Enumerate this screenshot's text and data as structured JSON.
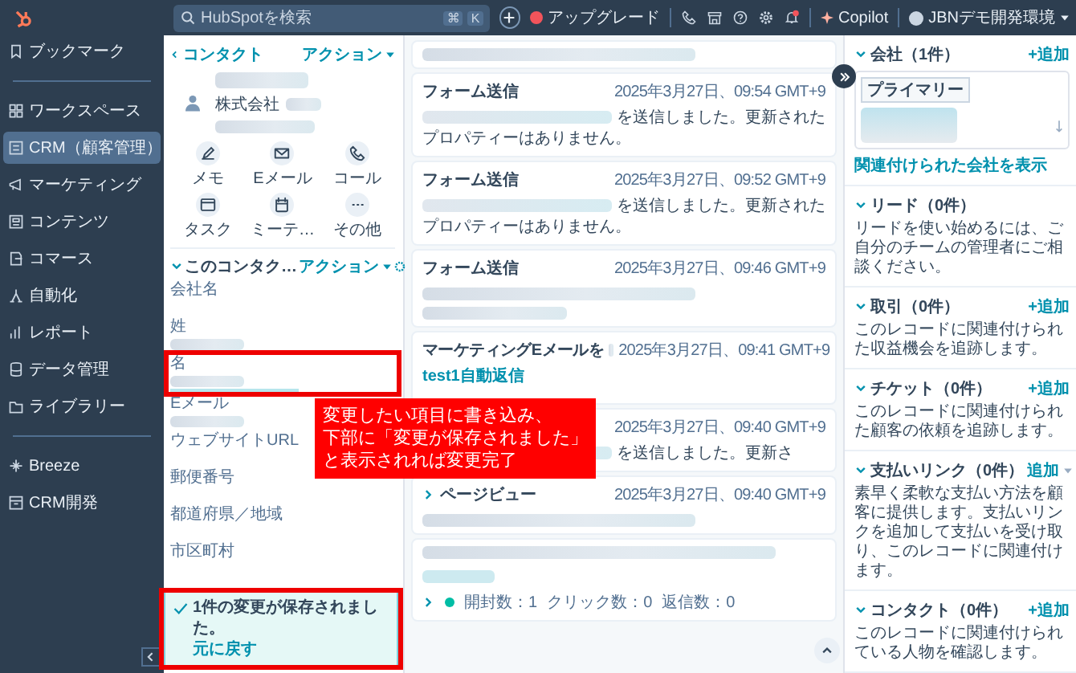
{
  "topbar": {
    "search": {
      "placeholder": "HubSpotを検索",
      "keys": [
        "⌘",
        "K"
      ]
    },
    "upgrade": "アップグレード",
    "copilot": "Copilot",
    "account": "JBNデモ開発環境",
    "has_notification": true
  },
  "sidebar": {
    "groups": [
      [
        {
          "label": "ブックマーク",
          "selected": false
        }
      ],
      [
        {
          "label": "ワークスペース",
          "selected": false
        },
        {
          "label": "CRM（顧客管理）",
          "selected": true
        },
        {
          "label": "マーケティング",
          "selected": false
        },
        {
          "label": "コンテンツ",
          "selected": false
        },
        {
          "label": "コマース",
          "selected": false
        },
        {
          "label": "自動化",
          "selected": false
        },
        {
          "label": "レポート",
          "selected": false
        },
        {
          "label": "データ管理",
          "selected": false
        },
        {
          "label": "ライブラリー",
          "selected": false
        }
      ],
      [
        {
          "label": "Breeze",
          "selected": false
        },
        {
          "label": "CRM開発",
          "selected": false
        }
      ]
    ]
  },
  "contact": {
    "back_link": "コンタクト",
    "actions_menu": "アクション",
    "company": "株式会社",
    "actions": [
      "メモ",
      "Eメール",
      "コール",
      "タスク",
      "ミーテ…",
      "その他"
    ],
    "about": {
      "title": "このコンタク…",
      "actions_menu": "アクション"
    },
    "fields": [
      {
        "label": "会社名",
        "redacted": false,
        "editing": false,
        "annotated": false
      },
      {
        "label": "姓",
        "redacted": true,
        "editing": false,
        "annotated": false
      },
      {
        "label": "名",
        "redacted": true,
        "editing": true,
        "annotated": true
      },
      {
        "label": "Eメール",
        "redacted": true,
        "editing": false,
        "annotated": false
      },
      {
        "label": "ウェブサイトURL",
        "redacted": false,
        "editing": false,
        "annotated": false
      },
      {
        "label": "郵便番号",
        "redacted": false,
        "editing": false,
        "annotated": false
      },
      {
        "label": "都道府県／地域",
        "redacted": false,
        "editing": false,
        "annotated": false
      },
      {
        "label": "市区町村",
        "redacted": false,
        "editing": false,
        "annotated": false
      }
    ],
    "toast": {
      "message": "1件の変更が保存されました。",
      "undo": "元に戻す",
      "annotated": true
    }
  },
  "timeline": [
    {
      "kind": "partial"
    },
    {
      "kind": "form",
      "title": "フォーム送信",
      "date": "2025年3月27日、09:54 GMT+9",
      "text": "を送信しました。更新されたプロパティーはありません。"
    },
    {
      "kind": "form",
      "title": "フォーム送信",
      "date": "2025年3月27日、09:52 GMT+9",
      "text": "を送信しました。更新されたプロパティーはありません。"
    },
    {
      "kind": "form",
      "title": "フォーム送信",
      "date": "2025年3月27日、09:46 GMT+9"
    },
    {
      "kind": "email",
      "title": "マーケティングEメールを",
      "date": "2025年3月27日、09:41 GMT+9",
      "link": "test1自動返信"
    },
    {
      "kind": "form",
      "date": "2025年3月27日、09:40 GMT+9",
      "text": "を送信しました。更新さ"
    },
    {
      "kind": "pageview",
      "title": "ページビュー",
      "date": "2025年3月27日、09:40 GMT+9"
    },
    {
      "kind": "email_stats",
      "stats": [
        "開封数：1",
        "クリック数：0",
        "返信数：0"
      ]
    }
  ],
  "annotation": {
    "lines": [
      "変更したい項目に書き込み、",
      "下部に「変更が保存されました」",
      "と表示されれば変更完了"
    ]
  },
  "right": {
    "sections": [
      {
        "kind": "company",
        "title": "会社（1件）",
        "add": "+追加",
        "add_menu": false,
        "tag": "プライマリー",
        "link": "関連付けられた会社を表示"
      },
      {
        "kind": "text",
        "title": "リード（0件）",
        "text": "リードを使い始めるには、ご自分のチームの管理者にご相談ください。"
      },
      {
        "kind": "text",
        "title": "取引（0件）",
        "add": "+追加",
        "add_menu": false,
        "text": "このレコードに関連付けられた収益機会を追跡します。"
      },
      {
        "kind": "text",
        "title": "チケット（0件）",
        "add": "+追加",
        "add_menu": false,
        "text": "このレコードに関連付けられた顧客の依頼を追跡します。"
      },
      {
        "kind": "text",
        "title": "支払いリンク（0件）",
        "add": "追加",
        "add_menu": true,
        "text": "素早く柔軟な支払い方法を顧客に提供します。支払いリンクを追加して支払いを受け取り、このレコードに関連付けます。"
      },
      {
        "kind": "text",
        "title": "コンタクト（0件）",
        "add": "+追加",
        "add_menu": false,
        "text": "このレコードに関連付けられている人物を確認します。"
      }
    ]
  }
}
